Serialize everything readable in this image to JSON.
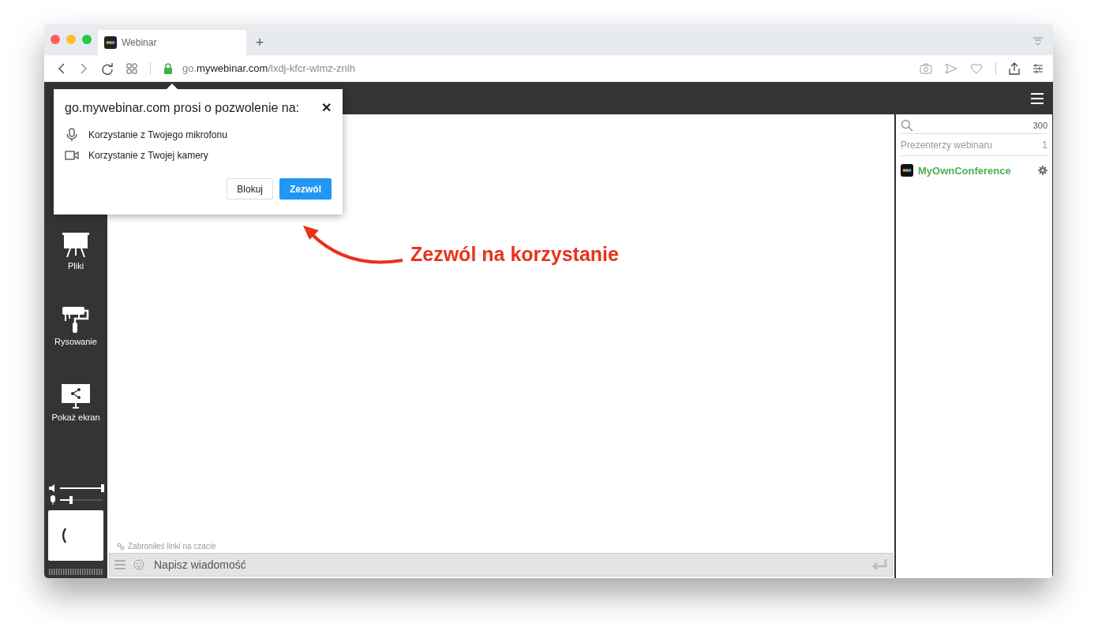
{
  "browser": {
    "tab": {
      "title": "Webinar"
    },
    "new_tab": "+",
    "url": {
      "host_prefix": "go.",
      "domain": "mywebinar.com",
      "path": "/lxdj-kfcr-wlmz-znlh"
    }
  },
  "permission_popup": {
    "title": "go.mywebinar.com prosi o pozwolenie na:",
    "close": "✕",
    "permissions": [
      {
        "kind": "microphone",
        "label": "Korzystanie z Twojego mikrofonu"
      },
      {
        "kind": "camera",
        "label": "Korzystanie z Twojej kamery"
      }
    ],
    "buttons": [
      {
        "label": "Blokuj",
        "primary": false
      },
      {
        "label": "Zezwól",
        "primary": true
      }
    ]
  },
  "sidebar": {
    "items": [
      {
        "kind": "files",
        "label": "Pliki"
      },
      {
        "kind": "drawing",
        "label": "Rysowanie"
      },
      {
        "kind": "screen",
        "label": "Pokaż ekran"
      }
    ],
    "speaker": {
      "level": 1.0
    },
    "microphone": {
      "level": 0.25
    }
  },
  "chat": {
    "notice": "Zabroniłeś linki na czacie",
    "input": {
      "placeholder": "Napisz wiadomość"
    }
  },
  "participants": {
    "count": "300",
    "section": {
      "title": "Prezenterzy webinaru",
      "count": "1"
    },
    "items": [
      {
        "name": "MyOwnConference"
      }
    ]
  },
  "annotation": {
    "text": "Zezwól na korzystanie"
  }
}
